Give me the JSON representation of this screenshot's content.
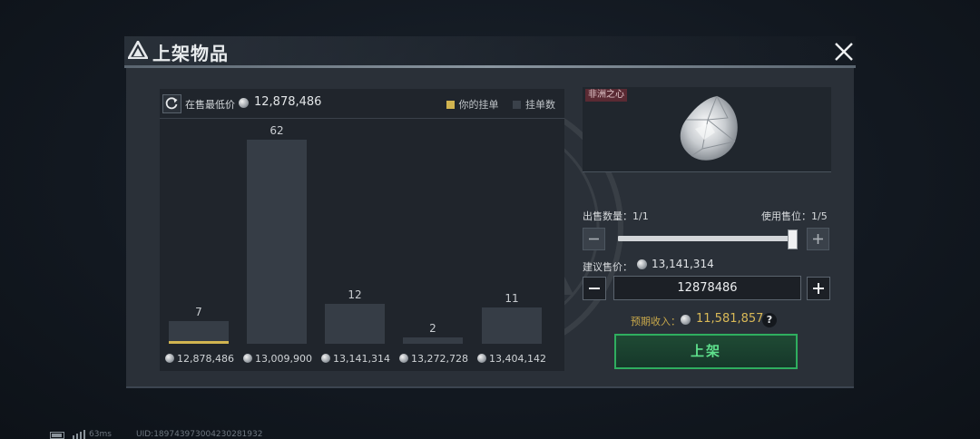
{
  "title": "上架物品",
  "chart_header": {
    "lowest_label": "在售最低价",
    "lowest_value": "12,878,486",
    "legend": [
      {
        "label": "你的挂单",
        "color": "#d1b450"
      },
      {
        "label": "挂单数",
        "color": "#3a414a"
      }
    ]
  },
  "chart_data": {
    "type": "bar",
    "categories": [
      "12,878,486",
      "13,009,900",
      "13,141,314",
      "13,272,728",
      "13,404,142"
    ],
    "series": [
      {
        "name": "挂单数",
        "values": [
          7,
          62,
          12,
          2,
          11
        ]
      },
      {
        "name": "你的挂单",
        "values": [
          1,
          0,
          0,
          0,
          0
        ]
      }
    ],
    "data_labels": [
      "7",
      "62",
      "12",
      "2",
      "11"
    ],
    "ylim": [
      0,
      62
    ]
  },
  "item": {
    "name_tag": "非洲之心"
  },
  "sell_quantity": {
    "label": "出售数量：",
    "value": "1/1",
    "fraction": 1.0
  },
  "slots": {
    "label": "使用售位：",
    "value": "1/5"
  },
  "suggested_price": {
    "label": "建议售价：",
    "value": "13,141,314"
  },
  "price_input": {
    "value": "12878486"
  },
  "expected_income": {
    "label": "预期收入：",
    "value": "11,581,857",
    "help": "?"
  },
  "list_button": {
    "label": "上架"
  },
  "status_bar": {
    "ping": "63ms",
    "uid": "UID:18974397300423028193​2"
  },
  "colors": {
    "accent_green": "#2fae5f",
    "gold": "#d1b450",
    "tag_red": "#5a2a33"
  }
}
